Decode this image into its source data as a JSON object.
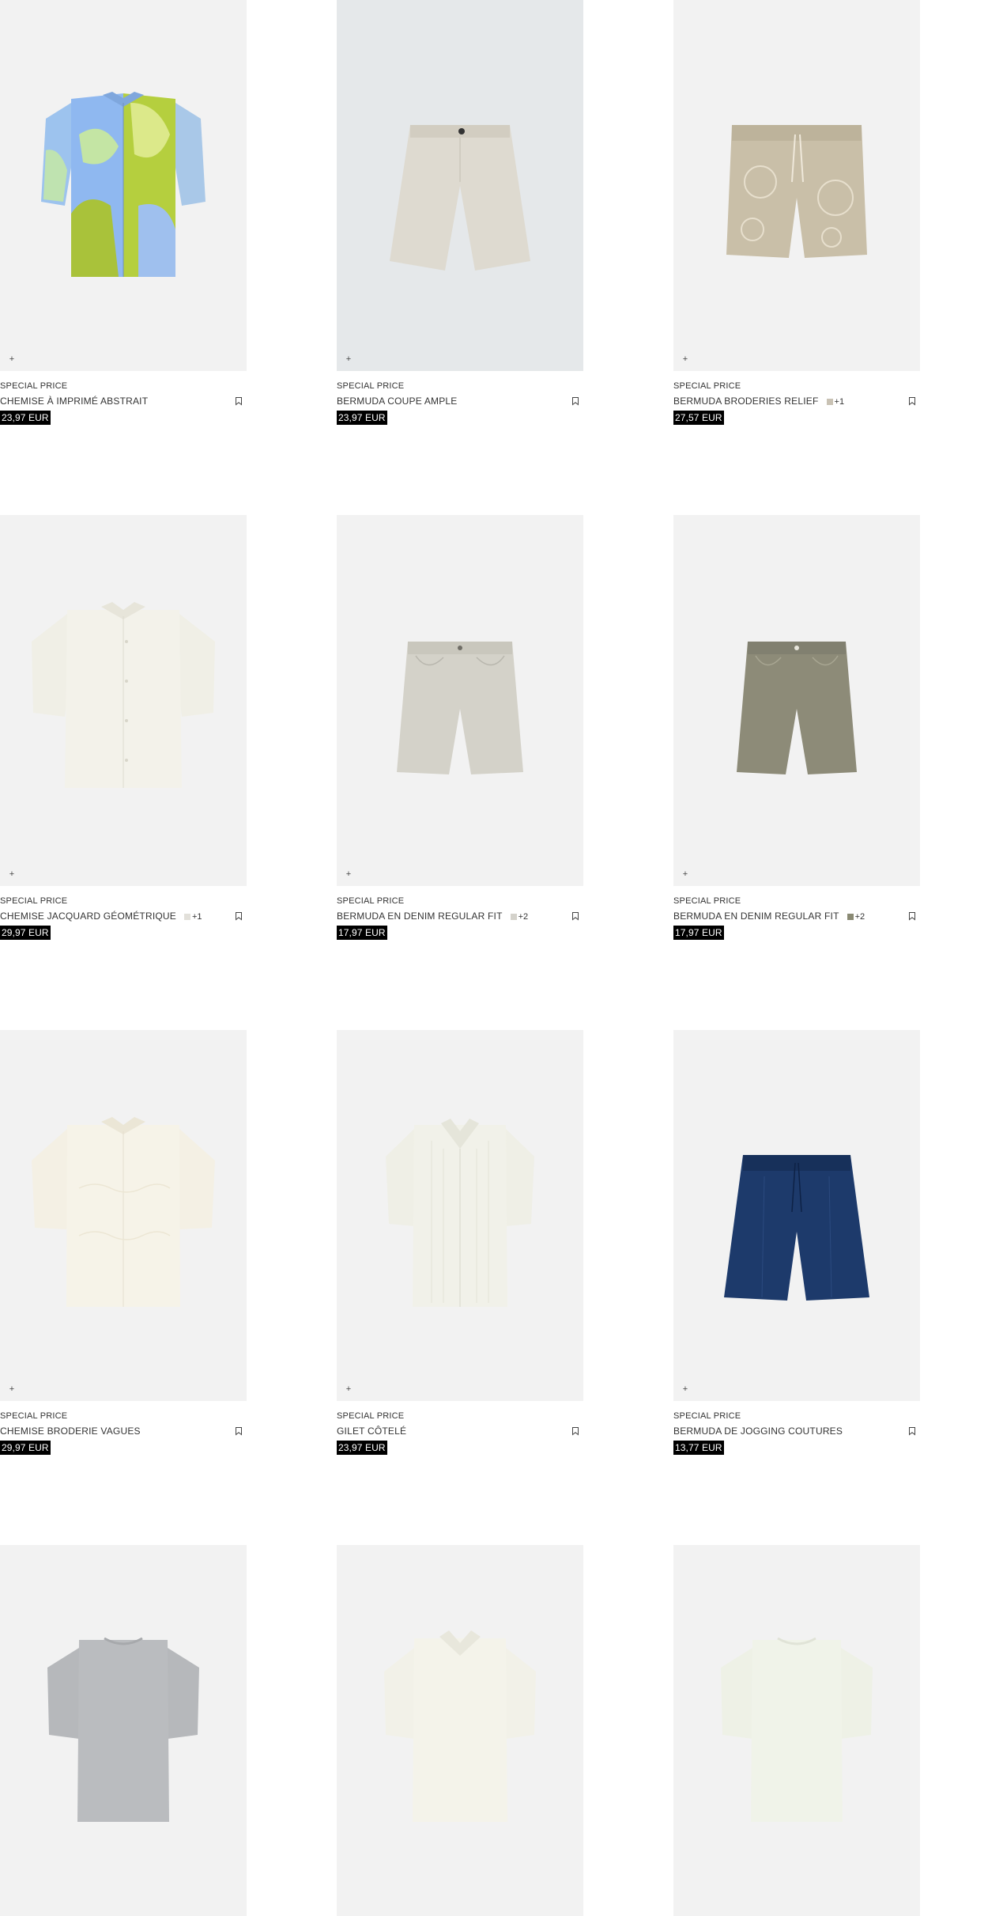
{
  "products": [
    {
      "label": "SPECIAL PRICE",
      "name": "CHEMISE À IMPRIMÉ ABSTRAIT",
      "price": "23,97 EUR",
      "swatch": "",
      "more": "",
      "add_icon": "+",
      "bookmark_icon": "bookmark-icon"
    },
    {
      "label": "SPECIAL PRICE",
      "name": "BERMUDA COUPE AMPLE",
      "price": "23,97 EUR",
      "swatch": "",
      "more": "",
      "add_icon": "+",
      "bookmark_icon": "bookmark-icon"
    },
    {
      "label": "SPECIAL PRICE",
      "name": "BERMUDA BRODERIES RELIEF",
      "price": "27,57 EUR",
      "swatch": "#c9c2b4",
      "more": "+1",
      "add_icon": "+",
      "bookmark_icon": "bookmark-icon"
    },
    {
      "label": "SPECIAL PRICE",
      "name": "CHEMISE JACQUARD GÉOMÉTRIQUE",
      "price": "29,97 EUR",
      "swatch": "#e2e0da",
      "more": "+1",
      "add_icon": "+",
      "bookmark_icon": "bookmark-icon"
    },
    {
      "label": "SPECIAL PRICE",
      "name": "BERMUDA EN DENIM REGULAR FIT",
      "price": "17,97 EUR",
      "swatch": "#d4d2cb",
      "more": "+2",
      "add_icon": "+",
      "bookmark_icon": "bookmark-icon"
    },
    {
      "label": "SPECIAL PRICE",
      "name": "BERMUDA EN DENIM REGULAR FIT",
      "price": "17,97 EUR",
      "swatch": "#8a8a74",
      "more": "+2",
      "add_icon": "+",
      "bookmark_icon": "bookmark-icon"
    },
    {
      "label": "SPECIAL PRICE",
      "name": "CHEMISE BRODERIE VAGUES",
      "price": "29,97 EUR",
      "swatch": "",
      "more": "",
      "add_icon": "+",
      "bookmark_icon": "bookmark-icon"
    },
    {
      "label": "SPECIAL PRICE",
      "name": "GILET CÔTELÉ",
      "price": "23,97 EUR",
      "swatch": "",
      "more": "",
      "add_icon": "+",
      "bookmark_icon": "bookmark-icon"
    },
    {
      "label": "SPECIAL PRICE",
      "name": "BERMUDA DE JOGGING COUTURES",
      "price": "13,77 EUR",
      "swatch": "",
      "more": "",
      "add_icon": "+",
      "bookmark_icon": "bookmark-icon"
    },
    {
      "label": "",
      "name": "",
      "price": "",
      "swatch": "",
      "more": "",
      "add_icon": "",
      "bookmark_icon": ""
    },
    {
      "label": "",
      "name": "",
      "price": "",
      "swatch": "",
      "more": "",
      "add_icon": "",
      "bookmark_icon": ""
    },
    {
      "label": "",
      "name": "",
      "price": "",
      "swatch": "",
      "more": "",
      "add_icon": "",
      "bookmark_icon": ""
    }
  ],
  "colors": {
    "image_bg": "#f2f2f2",
    "image_bg_alt": "#e5e8ea",
    "price_bg": "#000000",
    "price_text": "#ffffff",
    "text": "#333333"
  }
}
